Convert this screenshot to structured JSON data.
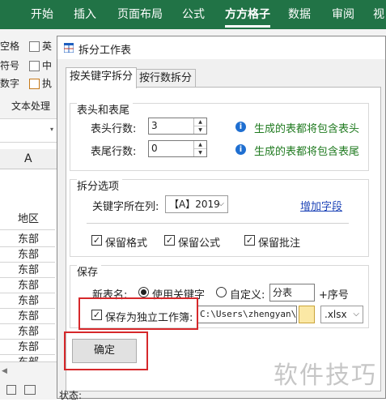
{
  "excel": {
    "ribbon_tabs": [
      "开始",
      "插入",
      "页面布局",
      "公式",
      "方方格子",
      "数据",
      "审阅",
      "视"
    ],
    "active_tab": "方方格子",
    "ribbon_items": [
      "空格",
      "符号",
      "数字",
      "英",
      "中",
      "执"
    ],
    "group_label": "文本处理",
    "column_header": "A",
    "cells": [
      "地区",
      "东部",
      "东部",
      "东部",
      "东部",
      "东部",
      "东部",
      "东部",
      "东部",
      "东部"
    ]
  },
  "dialog": {
    "title": "拆分工作表",
    "tabs": [
      "按关键字拆分",
      "按行数拆分"
    ],
    "header_group": {
      "title": "表头和表尾",
      "header_rows_label": "表头行数:",
      "header_rows_value": "3",
      "header_hint": "生成的表都将包含表头",
      "footer_rows_label": "表尾行数:",
      "footer_rows_value": "0",
      "footer_hint": "生成的表都将包含表尾"
    },
    "split_group": {
      "title": "拆分选项",
      "key_col_label": "关键字所在列:",
      "key_col_value": "【A】2019",
      "add_field_link": "增加字段",
      "keep_format": "保留格式",
      "keep_formula": "保留公式",
      "keep_comment": "保留批注"
    },
    "save_group": {
      "title": "保存",
      "new_name_label": "新表名:",
      "use_keyword": "使用关键字",
      "custom": "自定义:",
      "custom_value": "分表",
      "serial_suffix": "+序号",
      "save_independent": "保存为独立工作簿:",
      "path": "C:\\Users\\zhengyan\\De",
      "ext": ".xlsx"
    },
    "ok_button": "确定",
    "status_label": "状态:"
  },
  "watermark": "软件技巧"
}
